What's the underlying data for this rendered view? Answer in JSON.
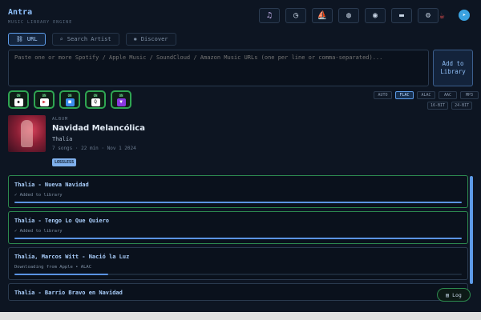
{
  "app": {
    "title": "Antra",
    "subtitle": "MUSIC LIBRARY ENGINE"
  },
  "toolbar": {
    "buttons": [
      {
        "name": "music-icon",
        "glyph": "♫"
      },
      {
        "name": "history-icon",
        "glyph": "◷"
      },
      {
        "name": "sailboat-icon",
        "glyph": "⛵"
      },
      {
        "name": "globe-icon",
        "glyph": "◍"
      },
      {
        "name": "palette-icon",
        "glyph": "◉"
      },
      {
        "name": "folder-icon",
        "glyph": "▬"
      },
      {
        "name": "gear-icon",
        "glyph": "⚙"
      }
    ],
    "coffee_icon": "☕",
    "telegram_icon": "➤"
  },
  "tabs": [
    {
      "label": "URL",
      "icon": "⛓",
      "active": true
    },
    {
      "label": "Search Artist",
      "icon": "⌕",
      "active": false
    },
    {
      "label": "Discover",
      "icon": "✱",
      "active": false
    }
  ],
  "input": {
    "placeholder": "Paste one or more Spotify / Apple Music / SoundCloud / Amazon Music URLs (one per line or comma-separated)...",
    "value": ""
  },
  "add_button": {
    "line1": "Add to",
    "line2": "Library"
  },
  "sources": [
    {
      "status": "ON",
      "name": "tidal",
      "glyph": "◆",
      "bg": "#ffffff",
      "fg": "#111111"
    },
    {
      "status": "ON",
      "name": "youtube-music",
      "glyph": "▶",
      "bg": "#ffffff",
      "fg": "#d11e2a"
    },
    {
      "status": "ON",
      "name": "apple-music",
      "glyph": "■",
      "bg": "#3b8ef0",
      "fg": "#ffffff"
    },
    {
      "status": "ON",
      "name": "qobuz",
      "glyph": "Q",
      "bg": "#ffffff",
      "fg": "#111111"
    },
    {
      "status": "ON",
      "name": "deezer",
      "glyph": "▼",
      "bg": "#8a38e0",
      "fg": "#ffffff"
    }
  ],
  "formats": [
    "AUTO",
    "FLAC",
    "ALAC",
    "AAC",
    "MP3"
  ],
  "active_format": "FLAC",
  "bit_depths": [
    "16-BIT",
    "24-BIT"
  ],
  "album": {
    "type": "ALBUM",
    "title": "Navidad Melancólica",
    "artist": "Thalía",
    "meta": "7 songs · 22 min · Nov 1 2024",
    "badge": "LOSSLESS"
  },
  "tracks": [
    {
      "name": "Thalía - Nueva Navidad",
      "status": "✓ Added to library",
      "progress": 1.0,
      "done": true
    },
    {
      "name": "Thalía - Tengo Lo Que Quiero",
      "status": "✓ Added to library",
      "progress": 1.0,
      "done": true
    },
    {
      "name": "Thalía, Marcos Witt - Nació la Luz",
      "status": "Downloading from Apple • ALAC",
      "progress": 0.21,
      "done": false
    },
    {
      "name": "Thalía - Barrio Bravo en Navidad",
      "status": "",
      "progress": 0,
      "done": false
    }
  ],
  "log_button": {
    "label": "Log",
    "icon": "▤"
  },
  "colors": {
    "accent": "#5b94e3",
    "success": "#2d8a4f",
    "background": "#0d1522"
  }
}
